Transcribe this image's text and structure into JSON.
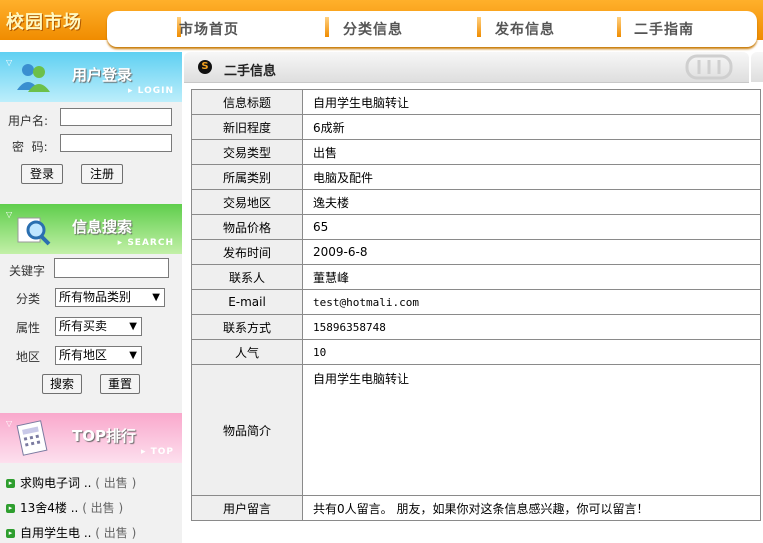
{
  "header": {
    "logo": "校园市场",
    "nav": [
      "市场首页",
      "分类信息",
      "发布信息",
      "二手指南"
    ]
  },
  "login": {
    "title": "用户登录",
    "subtitle": "LOGIN",
    "username_label": "用户名:",
    "password_label": "密  码:",
    "login_button": "登录",
    "register_button": "注册"
  },
  "search": {
    "title": "信息搜索",
    "subtitle": "SEARCH",
    "keyword_label": "关键字",
    "category_label": "分类",
    "category_value": "所有物品类别",
    "type_label": "属性",
    "type_value": "所有买卖",
    "area_label": "地区",
    "area_value": "所有地区",
    "search_button": "搜索",
    "reset_button": "重置"
  },
  "top": {
    "title": "TOP排行",
    "subtitle": "TOP",
    "items": [
      {
        "text": "求购电子词 ..",
        "tag": "( 出售 )"
      },
      {
        "text": "13舍4楼 ..",
        "tag": "( 出售 )"
      },
      {
        "text": "自用学生电 ..",
        "tag": "( 出售 )"
      }
    ]
  },
  "main": {
    "tab_title": "二手信息",
    "rows": [
      {
        "key": "信息标题",
        "value": "自用学生电脑转让"
      },
      {
        "key": "新旧程度",
        "value": "6成新"
      },
      {
        "key": "交易类型",
        "value": "出售"
      },
      {
        "key": "所属类别",
        "value": "电脑及配件"
      },
      {
        "key": "交易地区",
        "value": "逸夫楼"
      },
      {
        "key": "物品价格",
        "value": "65"
      },
      {
        "key": "发布时间",
        "value": "2009-6-8"
      },
      {
        "key": "联系人",
        "value": "董慧峰"
      },
      {
        "key": "E-mail",
        "value": "test@hotmali.com"
      },
      {
        "key": "联系方式",
        "value": "15896358748"
      },
      {
        "key": "人气",
        "value": "10"
      }
    ],
    "description_label": "物品简介",
    "description": "自用学生电脑转让",
    "message_label": "用户留言",
    "message": "共有0人留言。 朋友，如果你对这条信息感兴趣，你可以留言！"
  }
}
